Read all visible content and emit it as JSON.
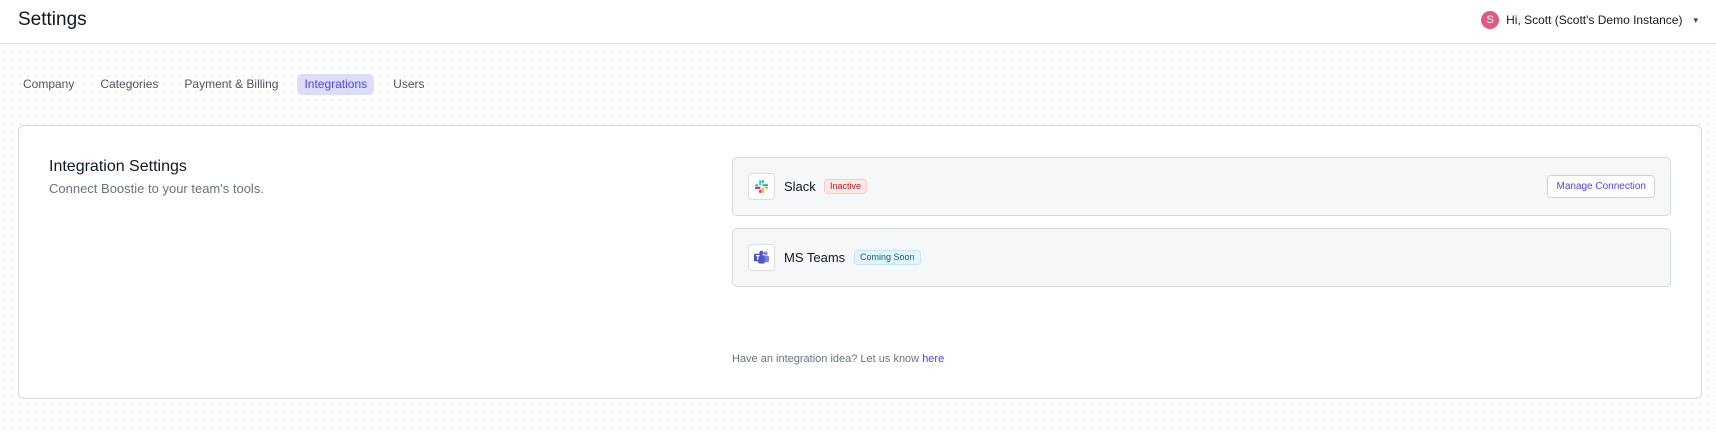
{
  "header": {
    "title": "Settings",
    "user": {
      "avatar_letter": "S",
      "avatar_color": "#e05a7f",
      "greeting": "Hi, Scott (Scott's Demo Instance)"
    }
  },
  "tabs": [
    {
      "label": "Company",
      "active": false
    },
    {
      "label": "Categories",
      "active": false
    },
    {
      "label": "Payment & Billing",
      "active": false
    },
    {
      "label": "Integrations",
      "active": true
    },
    {
      "label": "Users",
      "active": false
    }
  ],
  "section": {
    "title": "Integration Settings",
    "description": "Connect Boostie to your team's tools."
  },
  "integrations": [
    {
      "name": "Slack",
      "icon": "slack-icon",
      "status": "Inactive",
      "action_label": "Manage Connection"
    },
    {
      "name": "MS Teams",
      "icon": "ms-teams-icon",
      "status": "Coming Soon"
    }
  ],
  "footer": {
    "prefix": "Have an integration idea? Let us know ",
    "link_label": "here"
  },
  "colors": {
    "accent": "#4f46e5",
    "active_tab_bg": "#dcdcfb",
    "inactive_badge": "#b91c1c",
    "soon_badge": "#0f5f72"
  }
}
